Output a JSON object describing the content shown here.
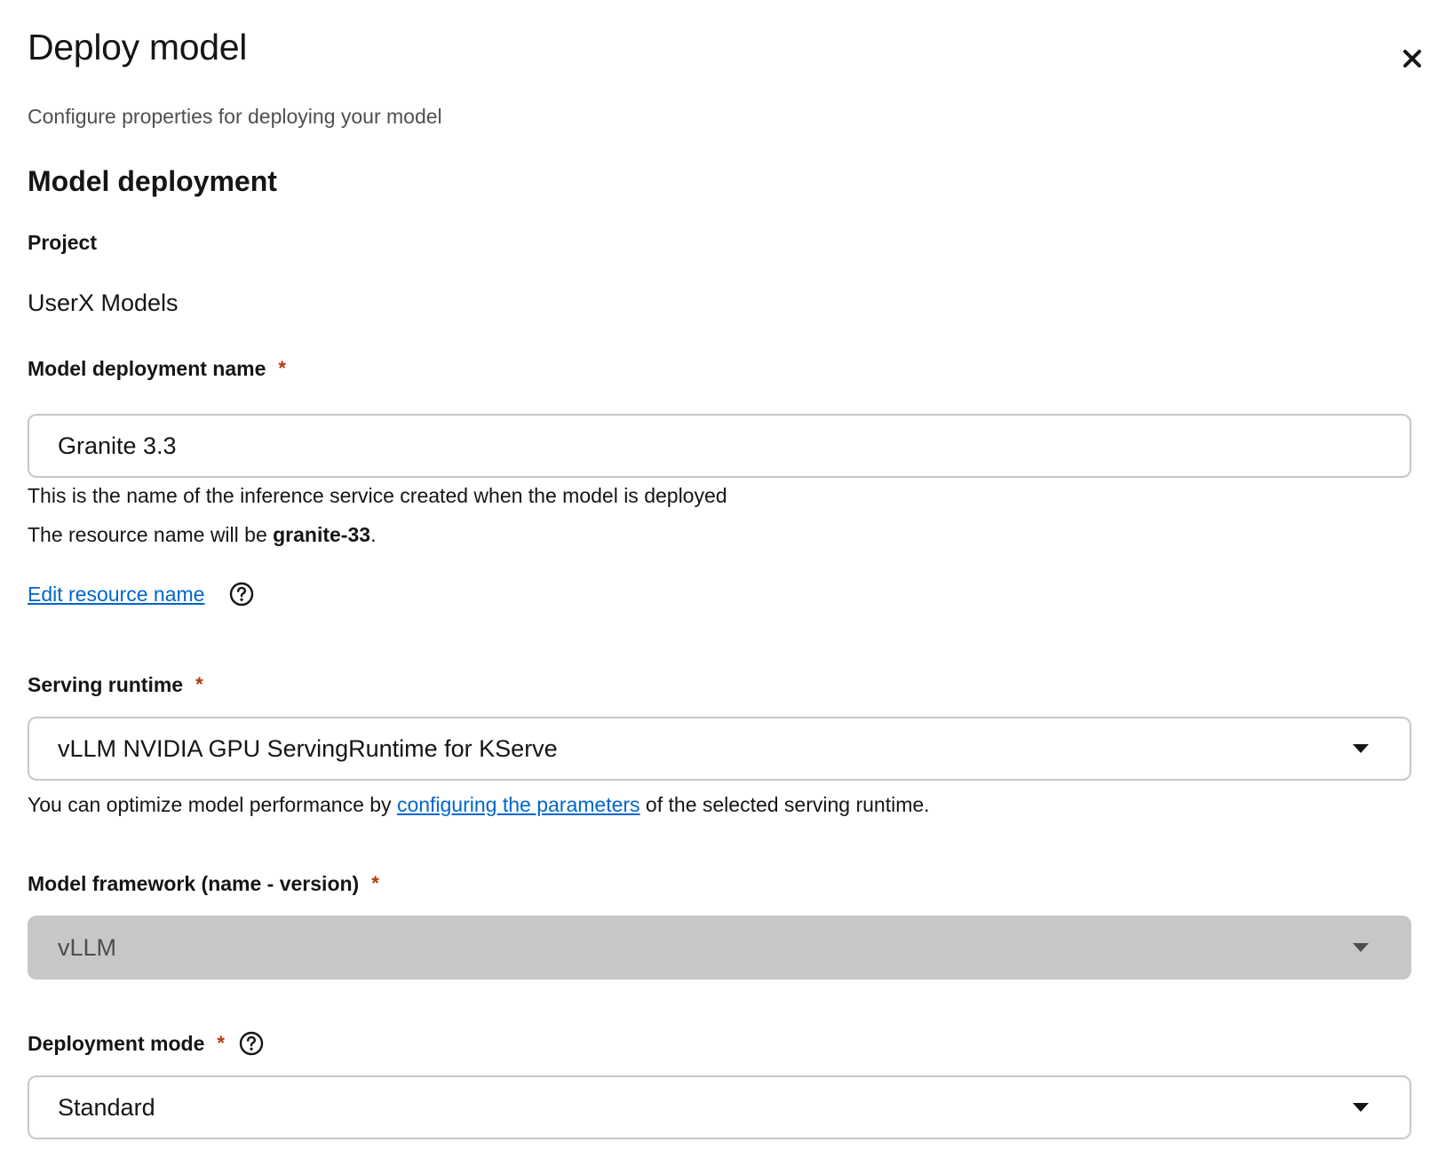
{
  "modal": {
    "title": "Deploy model",
    "description": "Configure properties for deploying your model",
    "close_icon": "close-icon"
  },
  "section": {
    "title": "Model deployment"
  },
  "project": {
    "label": "Project",
    "value": "UserX Models"
  },
  "deployment_name": {
    "label": "Model deployment name",
    "required_mark": "*",
    "value": "Granite 3.3",
    "helper": "This is the name of the inference service created when the model is deployed",
    "resource_prefix": "The resource name will be ",
    "resource_name": "granite-33",
    "resource_suffix": ".",
    "edit_link": "Edit resource name",
    "help_icon": "help-icon"
  },
  "serving_runtime": {
    "label": "Serving runtime",
    "required_mark": "*",
    "selected": "vLLM NVIDIA GPU ServingRuntime for KServe",
    "helper_prefix": "You can optimize model performance by ",
    "helper_link": "configuring the parameters",
    "helper_suffix": " of the selected serving runtime."
  },
  "model_framework": {
    "label": "Model framework (name - version)",
    "required_mark": "*",
    "selected": "vLLM",
    "disabled": true
  },
  "deployment_mode": {
    "label": "Deployment mode",
    "required_mark": "*",
    "help_icon": "help-icon",
    "selected": "Standard"
  },
  "colors": {
    "link": "#0066cc",
    "required": "#b1380b",
    "border": "#c7c7c7",
    "disabled_bg": "#c7c7c7",
    "text": "#151515"
  }
}
